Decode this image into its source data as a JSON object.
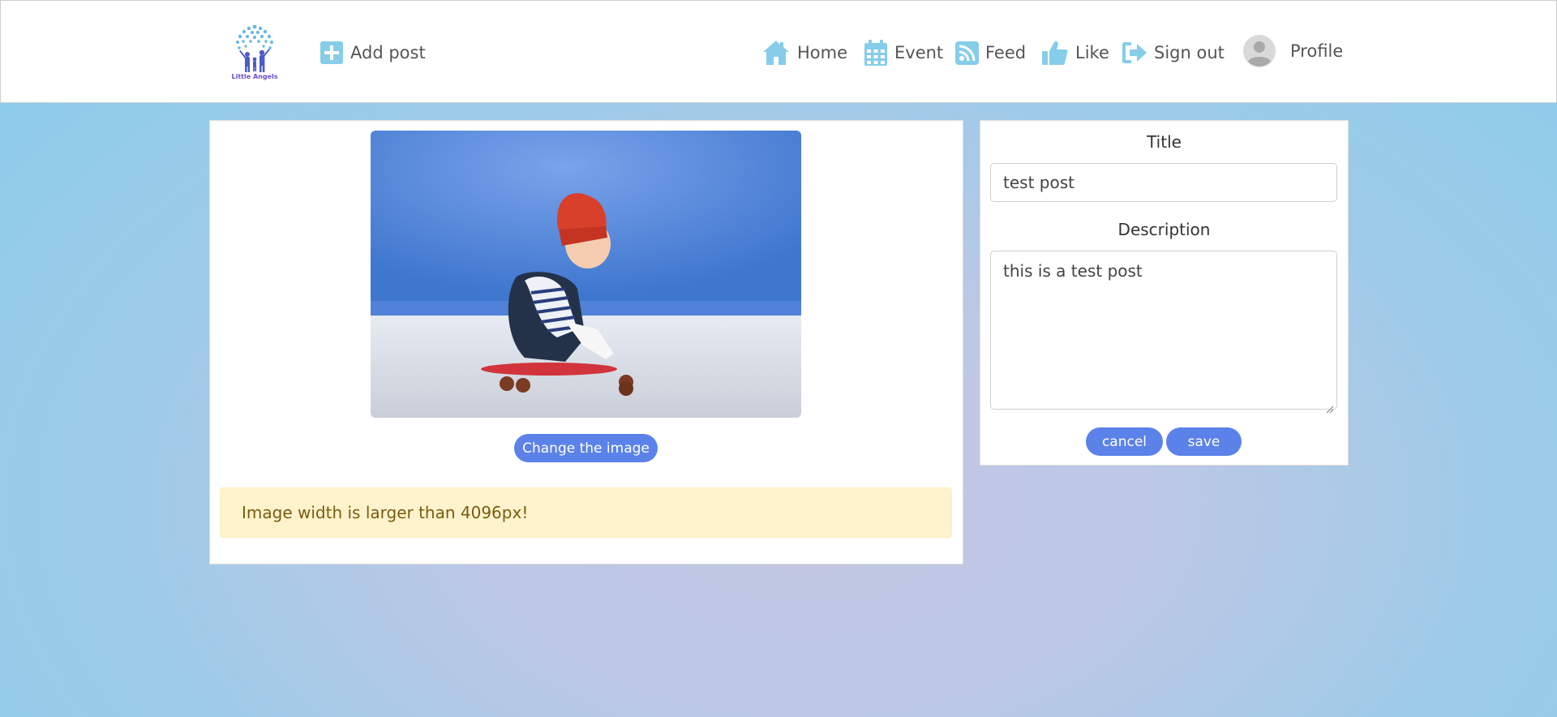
{
  "header": {
    "logo_text": "Little Angels",
    "add_post": "Add post",
    "nav": {
      "home": "Home",
      "event": "Event",
      "feed": "Feed",
      "like": "Like",
      "sign_out": "Sign out",
      "profile": "Profile"
    },
    "icon_color": "#86cdea"
  },
  "editor": {
    "change_image_label": "Change the image",
    "alert_text": "Image width is larger than 4096px!"
  },
  "form": {
    "title_label": "Title",
    "title_value": "test post",
    "description_label": "Description",
    "description_value": "this is a test post",
    "cancel_label": "cancel",
    "save_label": "save"
  },
  "colors": {
    "accent": "#5b82e8",
    "alert_bg": "#fff3cd",
    "alert_text": "#7a5b10"
  }
}
